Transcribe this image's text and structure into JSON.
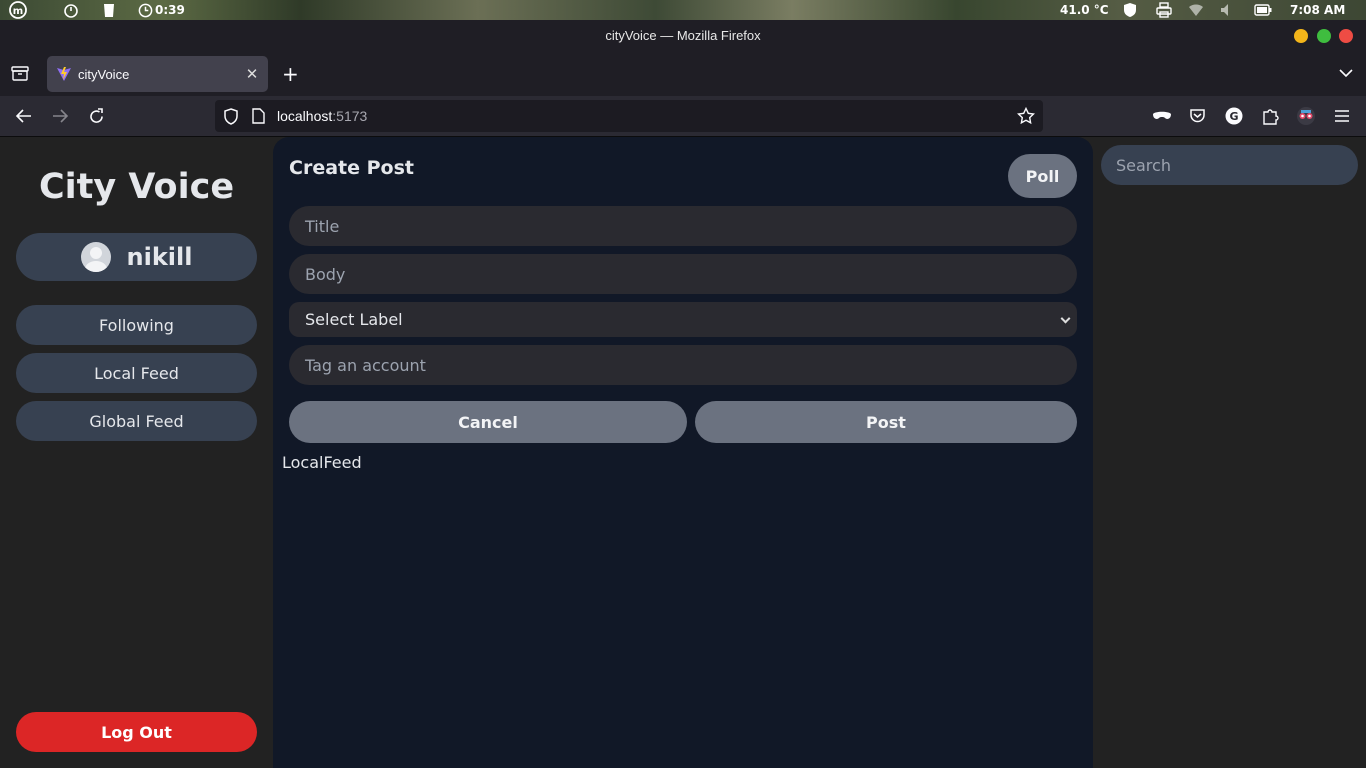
{
  "os_panel": {
    "timer": "0:39",
    "temperature": "41.0 °C",
    "clock": "7:08 AM"
  },
  "window": {
    "title": "cityVoice — Mozilla Firefox"
  },
  "tabs": [
    {
      "label": "cityVoice",
      "active": true
    }
  ],
  "navbar": {
    "url_host": "localhost",
    "url_port": ":5173"
  },
  "sidebar": {
    "brand": "City Voice",
    "username": "nikill",
    "items": [
      {
        "label": "Following"
      },
      {
        "label": "Local Feed"
      },
      {
        "label": "Global Feed"
      }
    ],
    "logout_label": "Log Out"
  },
  "create_post": {
    "heading": "Create Post",
    "poll_label": "Poll",
    "title_placeholder": "Title",
    "body_placeholder": "Body",
    "label_select_value": "Select Label",
    "tag_placeholder": "Tag an account",
    "cancel_label": "Cancel",
    "post_label": "Post"
  },
  "feed": {
    "label": "LocalFeed"
  },
  "search": {
    "placeholder": "Search"
  },
  "colors": {
    "logout": "#dc2626",
    "main_bg": "#111827",
    "pill_bg": "#374151",
    "button_gray": "#6b7280"
  }
}
